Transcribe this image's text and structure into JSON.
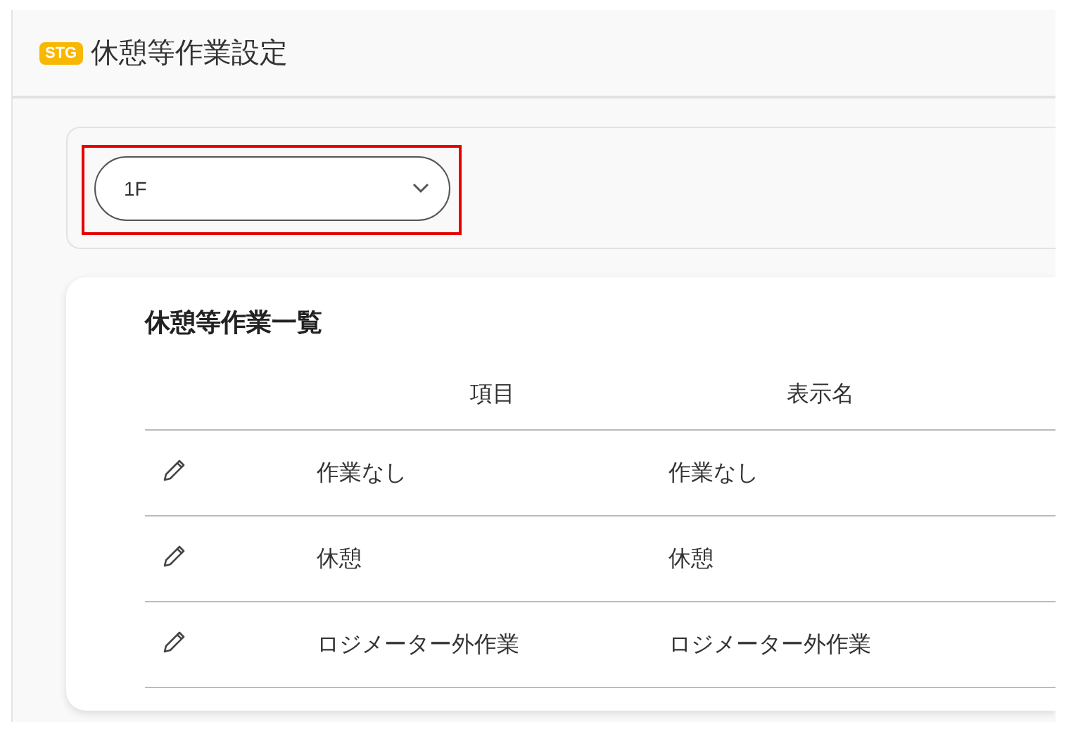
{
  "header": {
    "badge": "STG",
    "title": "休憩等作業設定"
  },
  "filter": {
    "value": "1F",
    "highlighted": true
  },
  "table": {
    "title": "休憩等作業一覧",
    "columns": [
      "項目",
      "表示名"
    ],
    "rows": [
      {
        "item": "作業なし",
        "display_name": "作業なし"
      },
      {
        "item": "休憩",
        "display_name": "休憩"
      },
      {
        "item": "ロジメーター外作業",
        "display_name": "ロジメーター外作業"
      }
    ]
  }
}
